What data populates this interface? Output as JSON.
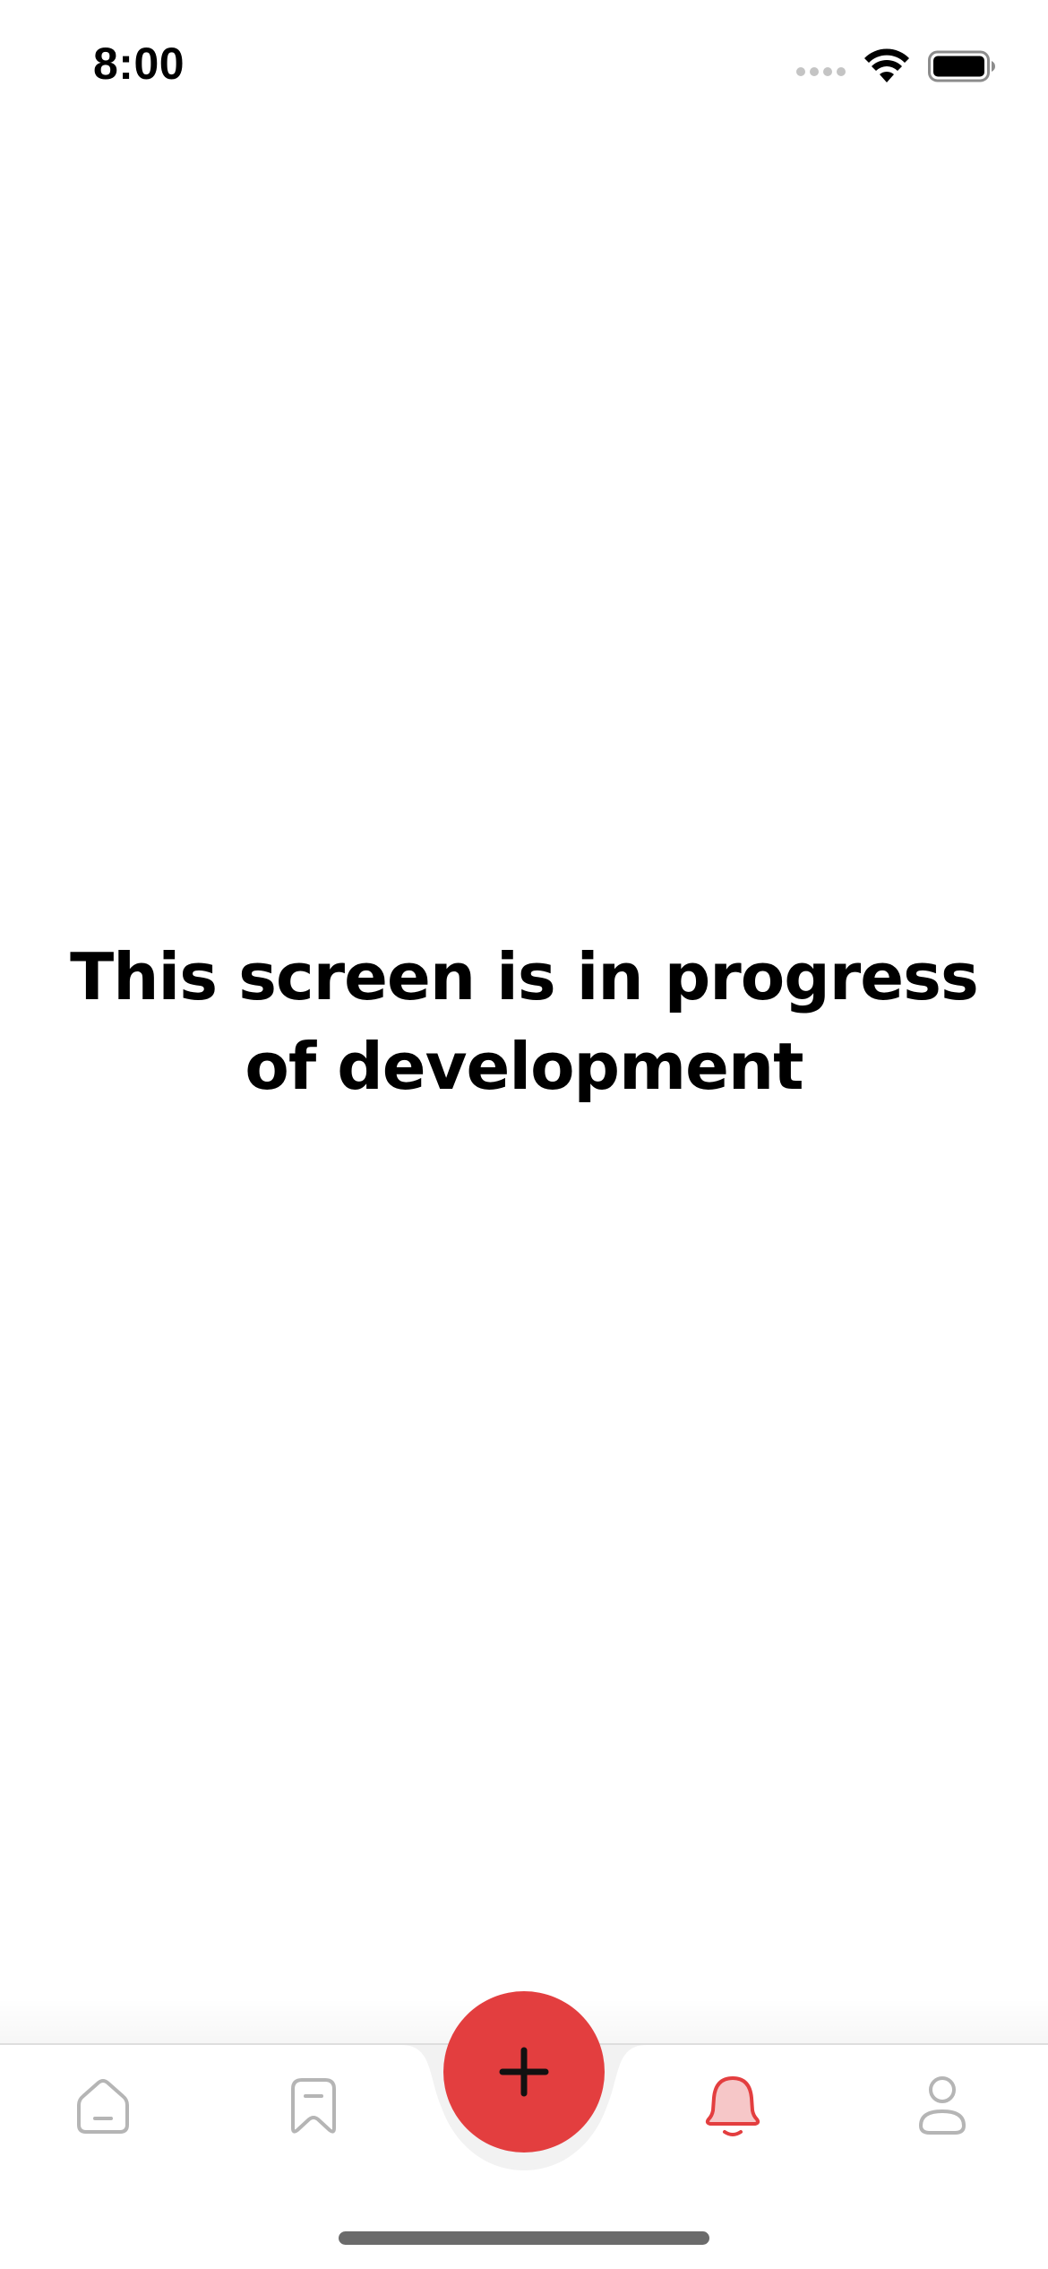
{
  "status_bar": {
    "time": "8:00",
    "icons": [
      "cellular-signal-icon",
      "wifi-icon",
      "battery-icon"
    ]
  },
  "main": {
    "message": "This screen is in progress of development"
  },
  "tab_bar": {
    "items": [
      {
        "name": "home",
        "icon": "home-icon",
        "active": false
      },
      {
        "name": "saved",
        "icon": "bookmark-icon",
        "active": false
      },
      {
        "name": "add",
        "icon": "plus-icon",
        "active": false
      },
      {
        "name": "notifications",
        "icon": "bell-icon",
        "active": true
      },
      {
        "name": "profile",
        "icon": "user-icon",
        "active": false
      }
    ]
  },
  "colors": {
    "accent": "#e33e3f",
    "inactive_icon": "#b5b5b5",
    "text": "#000000",
    "background": "#ffffff"
  }
}
